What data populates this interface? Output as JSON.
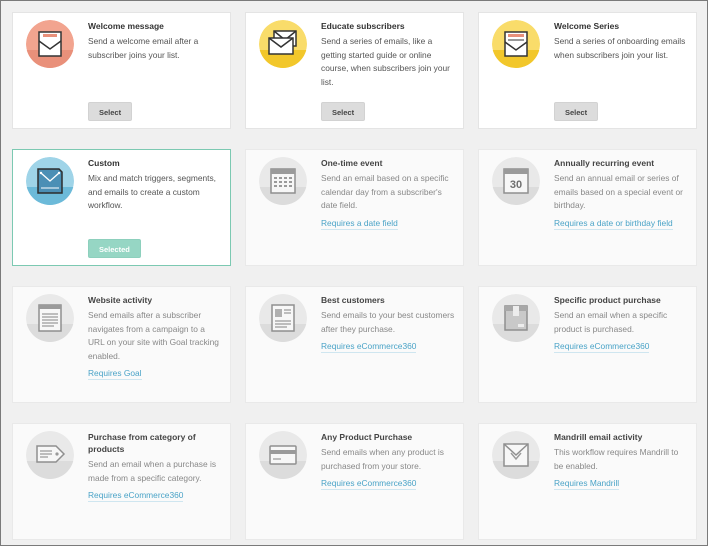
{
  "cards": [
    {
      "title": "Welcome message",
      "desc": "Send a welcome email after a subscriber joins your list.",
      "button": "Select",
      "icon": "envelope-icon",
      "bg": "#f2a48f"
    },
    {
      "title": "Educate subscribers",
      "desc": "Send a series of emails, like a getting started guide or online course, when subscribers join your list.",
      "button": "Select",
      "icon": "envelopes-icon",
      "bg": "#f7d44a"
    },
    {
      "title": "Welcome Series",
      "desc": "Send a series of onboarding emails when subscribers join your list.",
      "button": "Select",
      "icon": "welcome-series-icon",
      "bg": "#f7d44a"
    },
    {
      "title": "Custom",
      "desc": "Mix and match triggers, segments, and emails to create a custom workflow.",
      "button": "Selected",
      "icon": "custom-workflow-icon",
      "bg": "#7ec6df"
    },
    {
      "title": "One-time event",
      "desc": "Send an email based on a specific calendar day from a subscriber's date field.",
      "link": "Requires a date field",
      "icon": "calendar-icon"
    },
    {
      "title": "Annually recurring event",
      "desc": "Send an annual email or series of emails based on a special event or birthday.",
      "link": "Requires a date or birthday field",
      "icon": "calendar-30-icon",
      "day": "30"
    },
    {
      "title": "Website activity",
      "desc": "Send emails after a subscriber navigates from a campaign to a URL on your site with Goal tracking enabled.",
      "link": "Requires Goal",
      "icon": "webpage-icon"
    },
    {
      "title": "Best customers",
      "desc": "Send emails to your best customers after they purchase.",
      "link": "Requires eCommerce360",
      "icon": "customer-card-icon"
    },
    {
      "title": "Specific product purchase",
      "desc": "Send an email when a specific product is purchased.",
      "link": "Requires eCommerce360",
      "icon": "product-box-icon"
    },
    {
      "title": "Purchase from category of products",
      "desc": "Send an email when a purchase is made from a specific category.",
      "link": "Requires eCommerce360",
      "icon": "price-tag-icon"
    },
    {
      "title": "Any Product Purchase",
      "desc": "Send emails when any product is purchased from your store.",
      "link": "Requires eCommerce360",
      "icon": "credit-card-icon"
    },
    {
      "title": "Mandrill email activity",
      "desc": "This workflow requires Mandrill to be enabled.",
      "link": "Requires Mandrill",
      "icon": "mandrill-envelope-icon"
    }
  ]
}
